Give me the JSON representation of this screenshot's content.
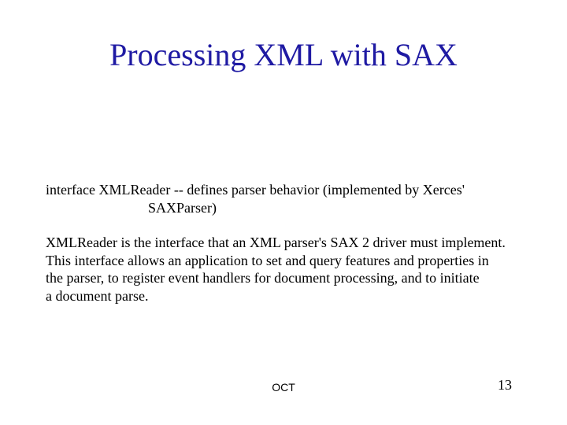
{
  "title": "Processing XML with SAX",
  "body": {
    "def_line1": "interface XMLReader  -- defines parser behavior (implemented by Xerces'",
    "def_line2": "SAXParser)",
    "para_l1": "XMLReader is the interface that an XML parser's SAX 2 driver must implement.",
    "para_l2": "This interface allows an application to set and query features and properties in",
    "para_l3": "the parser, to register event handlers for document processing, and to initiate",
    "para_l4": "a document parse."
  },
  "footer": {
    "center": "OCT",
    "page": "13"
  }
}
